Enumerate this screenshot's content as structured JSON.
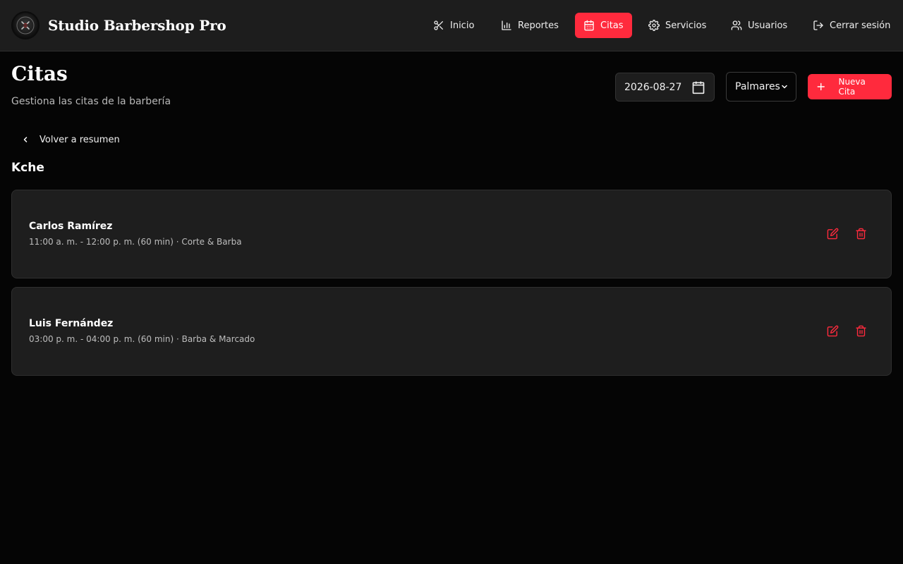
{
  "brand": {
    "name": "Studio Barbershop Pro"
  },
  "nav": {
    "items": [
      {
        "label": "Inicio",
        "icon": "scissors-icon"
      },
      {
        "label": "Reportes",
        "icon": "bar-chart-icon"
      },
      {
        "label": "Citas",
        "icon": "calendar-icon",
        "active": true
      },
      {
        "label": "Servicios",
        "icon": "gear-icon"
      },
      {
        "label": "Usuarios",
        "icon": "users-icon"
      },
      {
        "label": "Cerrar sesión",
        "icon": "logout-icon"
      }
    ]
  },
  "page": {
    "title": "Citas",
    "subtitle": "Gestiona las citas de la barbería"
  },
  "filters": {
    "date": "2026-08-27",
    "location": "Palmares",
    "new_label": "Nueva Cita"
  },
  "back": {
    "label": "Volver a resumen"
  },
  "section": {
    "title": "Kche"
  },
  "appointments": [
    {
      "client": "Carlos Ramírez",
      "detail": "11:00 a. m. - 12:00 p. m. (60 min) · Corte & Barba"
    },
    {
      "client": "Luis Fernández",
      "detail": "03:00 p. m. - 04:00 p. m. (60 min) · Barba & Marcado"
    }
  ],
  "colors": {
    "accent": "#ff2a3d",
    "background": "#050505",
    "surface": "#1e1e1e"
  }
}
